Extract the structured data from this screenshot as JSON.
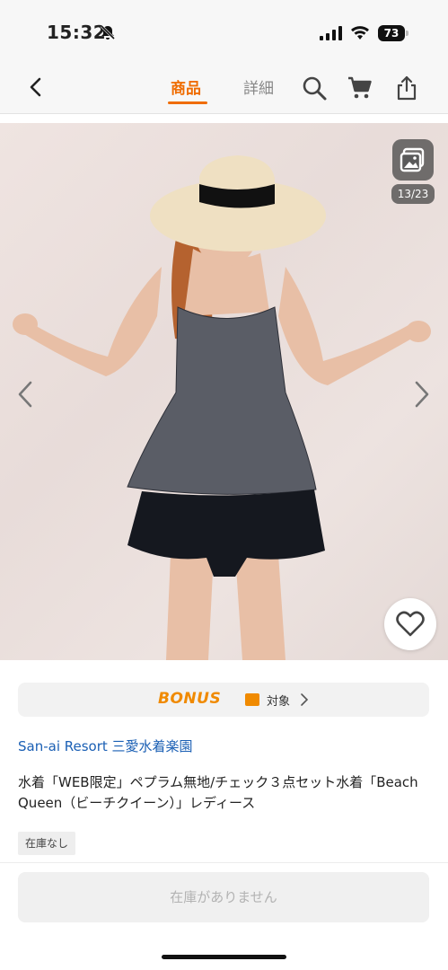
{
  "status_bar": {
    "time": "15:32",
    "battery": "73"
  },
  "nav": {
    "tabs": [
      {
        "label": "商品",
        "active": true
      },
      {
        "label": "詳細",
        "active": false
      }
    ]
  },
  "gallery": {
    "counter": "13/23"
  },
  "bonus": {
    "label": "BONUS",
    "target": "対象"
  },
  "product": {
    "shop": "San-ai Resort 三愛水着楽園",
    "title": "水着「WEB限定」ペプラム無地/チェック３点セット水着「Beach Queen（ビーチクイーン）」レディース",
    "stock_badge": "在庫なし",
    "cta_label": "在庫がありません"
  },
  "colors": {
    "accent": "#ef6c00",
    "bonus": "#f08a00",
    "link": "#1a5fb4"
  },
  "icons": [
    "back-chevron-icon",
    "search-icon",
    "cart-icon",
    "share-icon",
    "gallery-icon",
    "heart-icon",
    "chevron-left-icon",
    "chevron-right-icon"
  ]
}
